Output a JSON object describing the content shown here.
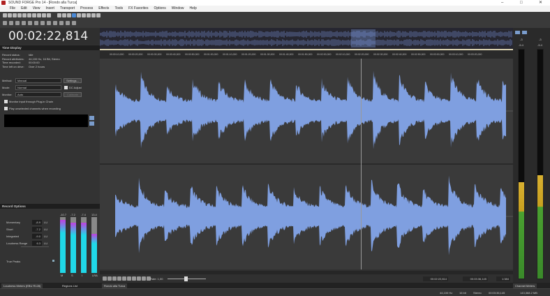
{
  "window": {
    "title": "SOUND FORGE Pro 14 - [Rondo alla Turca]",
    "min": "–",
    "max": "□",
    "close": "✕"
  },
  "menu": [
    "File",
    "Edit",
    "View",
    "Insert",
    "Transport",
    "Process",
    "Effects",
    "Tools",
    "FX Favorites",
    "Options",
    "Window",
    "Help"
  ],
  "time_display": {
    "value": "00:02:22,814",
    "panel_title": "Time Display"
  },
  "record": {
    "info": [
      [
        "Record status:",
        "Idle"
      ],
      [
        "Record attributes:",
        "44,100 Hz, 16 Bit, Stereo"
      ],
      [
        "Time recorded:",
        "00:00:00"
      ],
      [
        "Time left on drive:",
        "Over 2 hours"
      ]
    ],
    "method_label": "Method:",
    "method": "Manual",
    "mode_label": "Mode:",
    "mode": "Normal",
    "monitor_label": "Monitor:",
    "monitor": "Auto",
    "settings_button": "Settings...",
    "dc_adjust": "DC Adjust",
    "calibrate": "Calibrate",
    "monitor_plugin": "Monitor input through Plug-in Chain",
    "play_unselected": "Play unselected channels when recording",
    "panel_title": "Record Options"
  },
  "loudness": {
    "rows": [
      {
        "label": "Momentary",
        "value": "-8.9",
        "unit": "LU"
      },
      {
        "label": "Short",
        "value": "-7.2",
        "unit": "LU"
      },
      {
        "label": "Integrated",
        "value": "-9.0",
        "unit": "LU"
      },
      {
        "label": "Loudness Range",
        "value": "6.3",
        "unit": "LU"
      }
    ],
    "true_peaks": "True Peaks",
    "meter_peaks": [
      "-10.7",
      "-7.2",
      "-7.4",
      "13.4"
    ],
    "meter_levels": [
      0.95,
      0.9,
      0.9,
      0.7
    ],
    "meter_labels": [
      "M",
      "S",
      "I",
      "LRA"
    ]
  },
  "ruler": [
    "00:00:10,000",
    "00:00:20,000",
    "00:00:30,000",
    "00:00:40,000",
    "00:00:50,000",
    "00:01:00,000",
    "00:01:10,000",
    "00:01:20,000",
    "00:01:30,000",
    "00:01:40,000",
    "00:01:50,000",
    "00:02:00,000",
    "00:02:10,000",
    "00:02:20,000",
    "00:02:30,000",
    "00:02:40,000",
    "00:02:50,000",
    "00:03:00,000",
    "00:03:10,000",
    "00:03:20,000"
  ],
  "transport": {
    "rate": "Rate: 1,00",
    "position": "00:02:22,814",
    "length": "00:03:36,145",
    "zoom": "1:384"
  },
  "channel_meters": {
    "peaks": [
      "-3",
      "-3"
    ],
    "rms": [
      "-5.4",
      "-5.4"
    ],
    "levels": [
      0.42,
      0.45
    ],
    "title": "Channel Meters"
  },
  "tabs": {
    "loudness": "Loudness Meters (EBU R128)",
    "regions": "Regions List",
    "document": "Rondo alla Turca"
  },
  "status": {
    "rate": "44,100 Hz",
    "bits": "16 bit",
    "channels": "Stereo",
    "length": "00:03:36,145",
    "disk": "143,368.2 MB"
  },
  "colors": {
    "wave": "#7f9fe0",
    "meter_cyan": "#20d8e8",
    "meter_magenta": "#c040e0"
  }
}
